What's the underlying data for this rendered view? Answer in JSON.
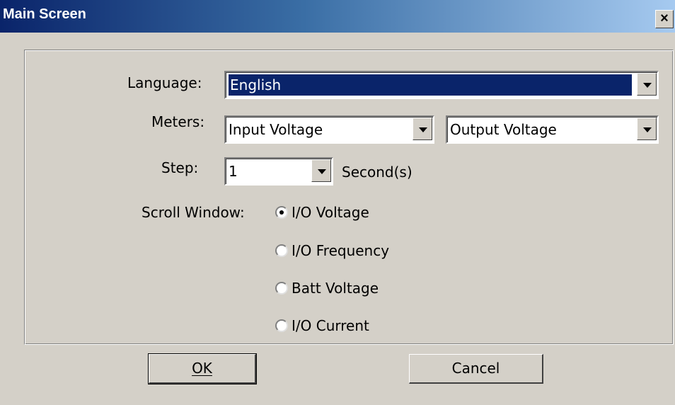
{
  "window": {
    "title": "Main Screen",
    "close_glyph": "×"
  },
  "form": {
    "language": {
      "label": "Language:",
      "value": "English"
    },
    "meters": {
      "label": "Meters:",
      "meter1": "Input Voltage",
      "meter2": "Output Voltage"
    },
    "step": {
      "label": "Step:",
      "value": "1",
      "unit": "Second(s)"
    },
    "scroll_window": {
      "label": "Scroll Window:",
      "options": [
        {
          "label": "I/O Voltage",
          "checked": true
        },
        {
          "label": "I/O Frequency",
          "checked": false
        },
        {
          "label": "Batt Voltage",
          "checked": false
        },
        {
          "label": "I/O Current",
          "checked": false
        }
      ]
    }
  },
  "buttons": {
    "ok": "OK",
    "cancel": "Cancel"
  },
  "colors": {
    "title_start": "#0a246a",
    "title_end": "#a6caf0",
    "face": "#d4d0c8",
    "selection": "#0a246a"
  }
}
